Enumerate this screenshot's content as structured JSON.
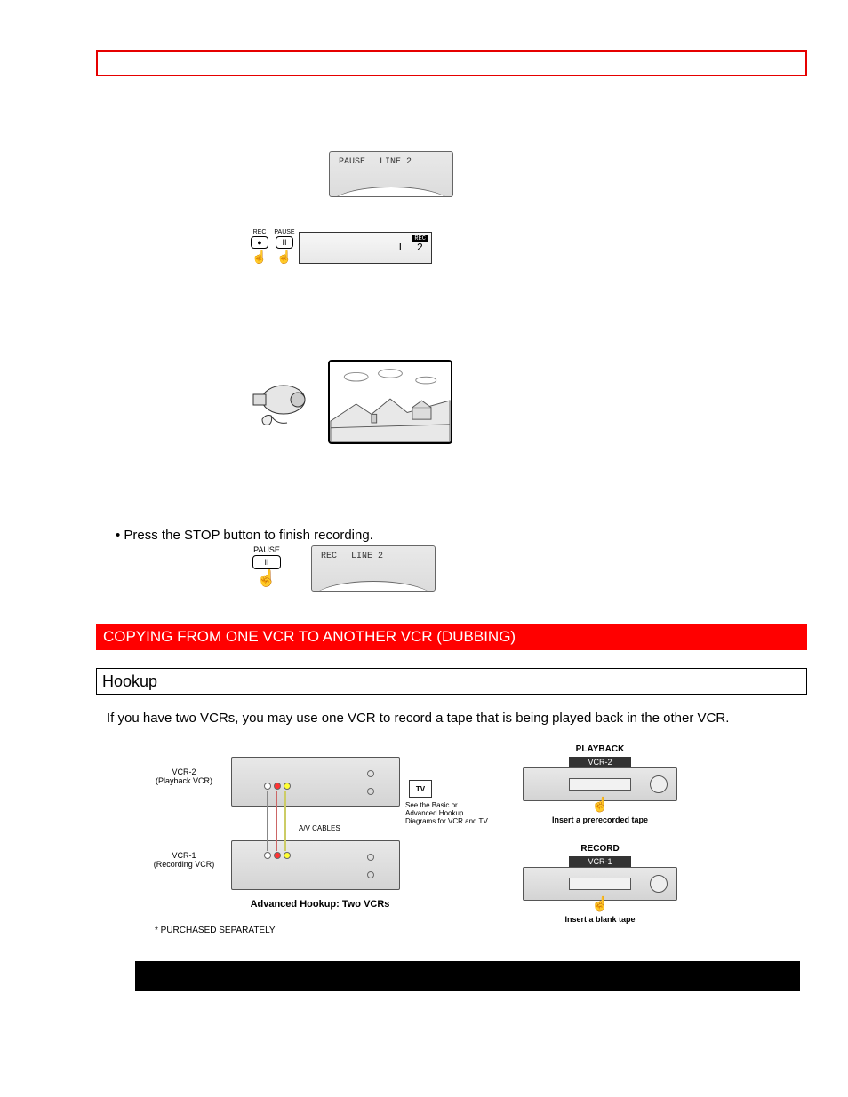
{
  "topbar": {},
  "fig1": {
    "display_text_left": "PAUSE",
    "display_text_right": "LINE 2"
  },
  "fig2": {
    "btn1_cap": "REC",
    "btn1_sym": "●",
    "btn2_cap": "PAUSE",
    "btn2_sym": "II",
    "lcd_text": "L 2",
    "rec_badge": "REC"
  },
  "fig3": {},
  "instruction1": "• Press the STOP button to finish recording.",
  "fig4": {
    "btn_cap": "PAUSE",
    "btn_sym": "II",
    "display_left": "REC",
    "display_right": "LINE 2"
  },
  "section_red": "COPYING FROM ONE VCR TO ANOTHER VCR (DUBBING)",
  "subhead": "Hookup",
  "paragraph": "If you have two VCRs, you may use one VCR to record a tape that is being played back in the other VCR.",
  "hookup_left": {
    "vcr2_label1": "VCR-2",
    "vcr2_label2": "(Playback VCR)",
    "vcr1_label1": "VCR-1",
    "vcr1_label2": "(Recording VCR)",
    "tv_label": "TV",
    "tv_note1": "See the Basic or",
    "tv_note2": "Advanced Hookup",
    "tv_note3": "Diagrams for VCR and TV",
    "cables_label": "A/V CABLES",
    "title": "Advanced Hookup: Two VCRs",
    "footnote": "*  PURCHASED SEPARATELY"
  },
  "hookup_right": {
    "playback_label": "PLAYBACK",
    "vcr2_badge": "VCR-2",
    "insert_pre": "Insert a prerecorded tape",
    "record_label": "RECORD",
    "vcr1_badge": "VCR-1",
    "insert_blank": "Insert a blank tape"
  }
}
